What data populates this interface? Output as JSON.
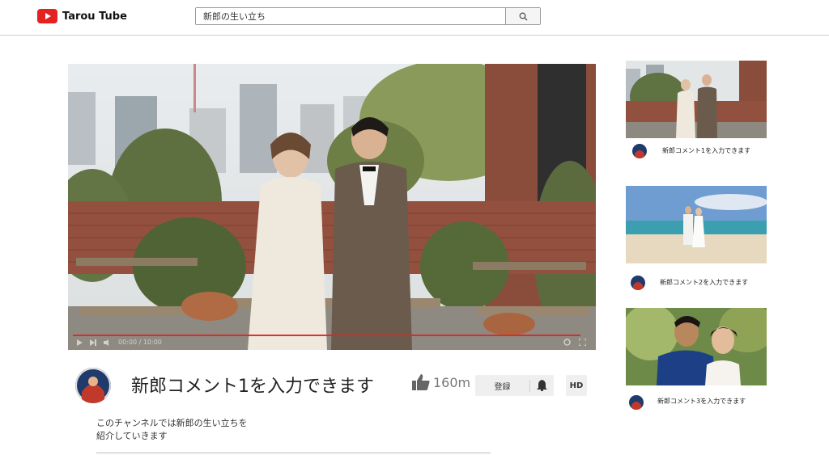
{
  "header": {
    "logo_text": "Tarou Tube",
    "search_value": "新郎の生い立ち",
    "icons": {
      "logo": "play-logo-icon",
      "search": "search-icon"
    }
  },
  "player": {
    "time_label": "00:00 / 10:00",
    "progress": 0.98,
    "icons": [
      "play-icon",
      "next-icon",
      "volume-icon",
      "settings-icon",
      "fullscreen-icon"
    ]
  },
  "video": {
    "title": "新郎コメント1を入力できます",
    "likes": "160m",
    "subscribe_label": "登録",
    "hd_label": "HD",
    "description_lines": [
      "このチャンネルでは新郎の生い立ちを",
      "紹介していきます"
    ]
  },
  "recommendations": [
    {
      "title": "新郎コメント1を入力できます"
    },
    {
      "title": "新郎コメント2を入力できます"
    },
    {
      "title": "新郎コメント3を入力できます"
    }
  ],
  "colors": {
    "brand_red": "#e52222",
    "progress_red": "#dc2828"
  }
}
